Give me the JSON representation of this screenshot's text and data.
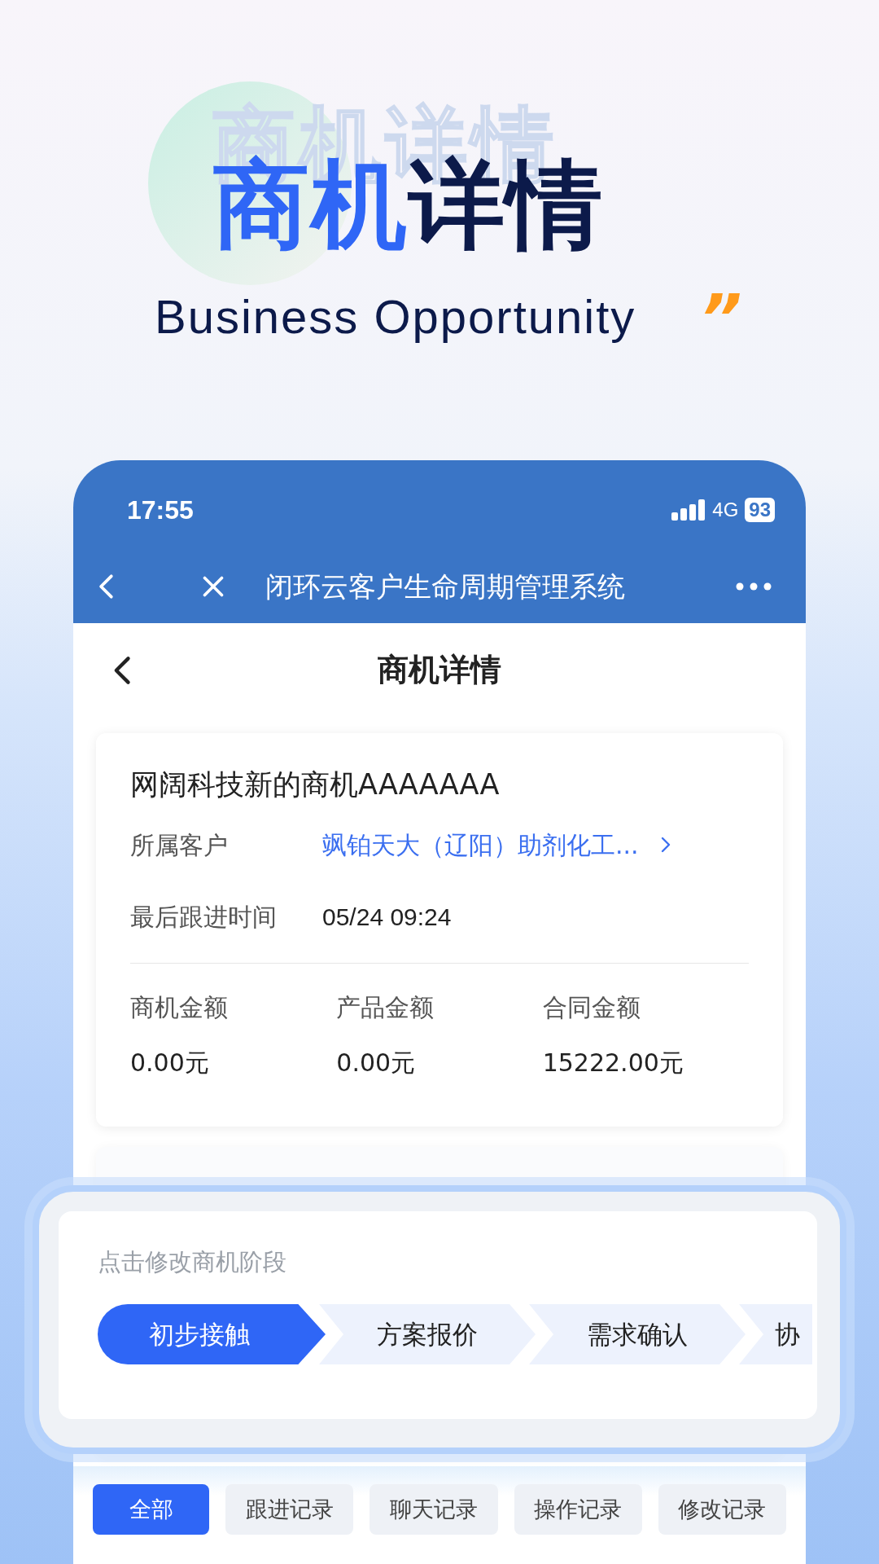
{
  "hero": {
    "ghost_title": "商机详情",
    "title_highlight": "商机",
    "title_rest": "详情",
    "subtitle": "Business Opportunity",
    "quote_mark": "”"
  },
  "status_bar": {
    "time": "17:55",
    "network": "4G",
    "battery": "93"
  },
  "nav_bar": {
    "title": "闭环云客户生命周期管理系统"
  },
  "page": {
    "title": "商机详情"
  },
  "card": {
    "name": "网阔科技新的商机AAAAAAA",
    "fields": [
      {
        "label": "所属客户",
        "value": "飒铂天大（辽阳）助剂化工...",
        "kind": "link"
      },
      {
        "label": "最后跟进时间",
        "value": "05/24 09:24",
        "kind": "text"
      }
    ],
    "amounts": [
      {
        "label": "商机金额",
        "value": "0.00元"
      },
      {
        "label": "产品金额",
        "value": "0.00元"
      },
      {
        "label": "合同金额",
        "value": "15222.00元"
      }
    ]
  },
  "stage_panel": {
    "hint": "点击修改商机阶段",
    "stages": [
      {
        "label": "初步接触",
        "selected": true
      },
      {
        "label": "方案报价",
        "selected": false
      },
      {
        "label": "需求确认",
        "selected": false
      },
      {
        "label": "协",
        "selected": false
      }
    ]
  },
  "record_tabs": [
    {
      "label": "全部",
      "selected": true
    },
    {
      "label": "跟进记录",
      "selected": false
    },
    {
      "label": "聊天记录",
      "selected": false
    },
    {
      "label": "操作记录",
      "selected": false
    },
    {
      "label": "修改记录",
      "selected": false
    }
  ]
}
